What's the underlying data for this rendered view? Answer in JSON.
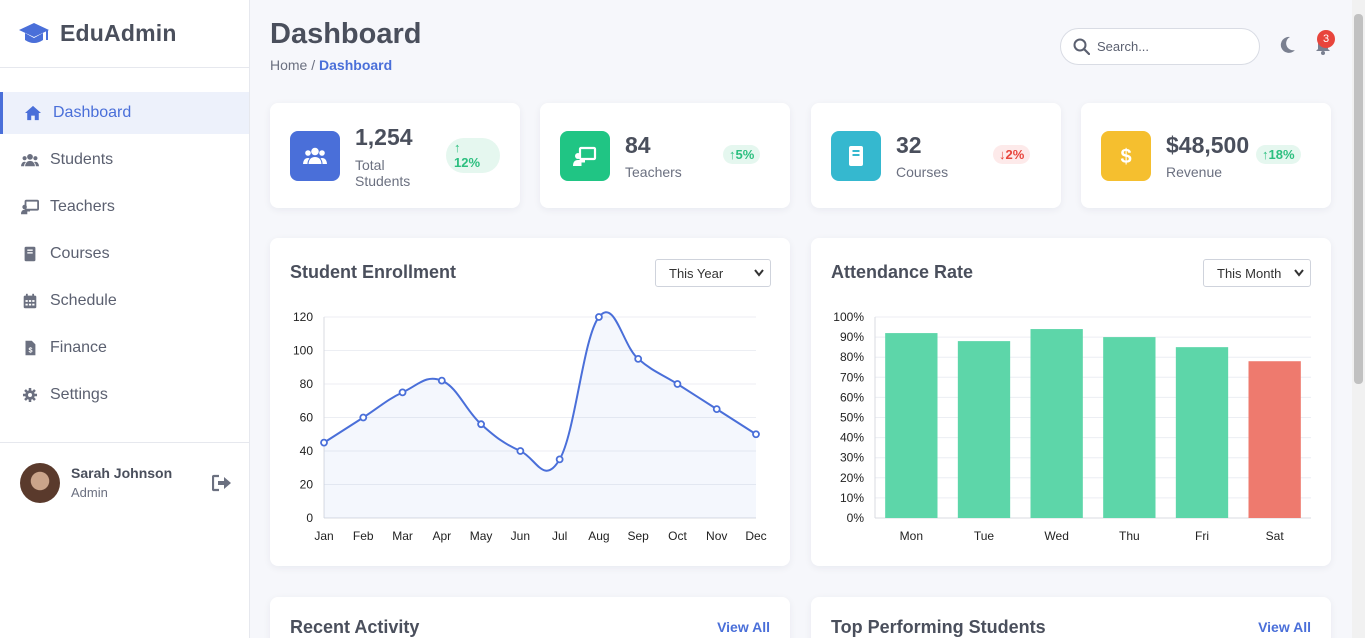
{
  "brand": {
    "name": "EduAdmin",
    "icon": "graduation-cap-icon",
    "color": "#4a6fd9"
  },
  "sidebar": {
    "items": [
      {
        "label": "Dashboard",
        "icon": "home-icon",
        "active": true
      },
      {
        "label": "Students",
        "icon": "users-icon"
      },
      {
        "label": "Teachers",
        "icon": "teacher-icon"
      },
      {
        "label": "Courses",
        "icon": "book-icon"
      },
      {
        "label": "Schedule",
        "icon": "calendar-icon"
      },
      {
        "label": "Finance",
        "icon": "invoice-icon"
      },
      {
        "label": "Settings",
        "icon": "gear-icon"
      }
    ],
    "user": {
      "name": "Sarah Johnson",
      "role": "Admin"
    }
  },
  "header": {
    "title": "Dashboard",
    "breadcrumb": {
      "home": "Home",
      "separator": " / ",
      "current": "Dashboard"
    },
    "search_placeholder": "Search...",
    "notification_count": "3"
  },
  "stats": [
    {
      "value": "1,254",
      "label": "Total Students",
      "trend": "12%",
      "direction": "up",
      "color": "#4a6fd9",
      "icon": "users-icon"
    },
    {
      "value": "84",
      "label": "Teachers",
      "trend": "5%",
      "direction": "up",
      "color": "#20c584",
      "icon": "teacher-icon"
    },
    {
      "value": "32",
      "label": "Courses",
      "trend": "2%",
      "direction": "down",
      "color": "#35b8cf",
      "icon": "book-icon"
    },
    {
      "value": "$48,500",
      "label": "Revenue",
      "trend": "18%",
      "direction": "up",
      "color": "#f5bf2f",
      "icon": "dollar-icon"
    }
  ],
  "enrollment": {
    "title": "Student Enrollment",
    "filter": "This Year"
  },
  "attendance": {
    "title": "Attendance Rate",
    "filter": "This Month"
  },
  "chart_data": [
    {
      "type": "line",
      "title": "Student Enrollment",
      "categories": [
        "Jan",
        "Feb",
        "Mar",
        "Apr",
        "May",
        "Jun",
        "Jul",
        "Aug",
        "Sep",
        "Oct",
        "Nov",
        "Dec"
      ],
      "values": [
        45,
        60,
        75,
        82,
        56,
        40,
        35,
        120,
        95,
        80,
        65,
        50
      ],
      "yticks": [
        "0",
        "20",
        "40",
        "60",
        "80",
        "100",
        "120"
      ],
      "ylim": [
        0,
        120
      ],
      "color": "#4a6fd9",
      "fill": true,
      "grid": true
    },
    {
      "type": "bar",
      "title": "Attendance Rate",
      "categories": [
        "Mon",
        "Tue",
        "Wed",
        "Thu",
        "Fri",
        "Sat"
      ],
      "values": [
        92,
        88,
        94,
        90,
        85,
        78
      ],
      "colors": [
        "#5dd6a9",
        "#5dd6a9",
        "#5dd6a9",
        "#5dd6a9",
        "#5dd6a9",
        "#ee7a6e"
      ],
      "yticks": [
        "0%",
        "10%",
        "20%",
        "30%",
        "40%",
        "50%",
        "60%",
        "70%",
        "80%",
        "90%",
        "100%"
      ],
      "ylim": [
        0,
        100
      ],
      "grid": true
    }
  ],
  "bottom": {
    "activity_title": "Recent Activity",
    "activity_link": "View All",
    "top_title": "Top Performing Students",
    "top_link": "View All"
  }
}
